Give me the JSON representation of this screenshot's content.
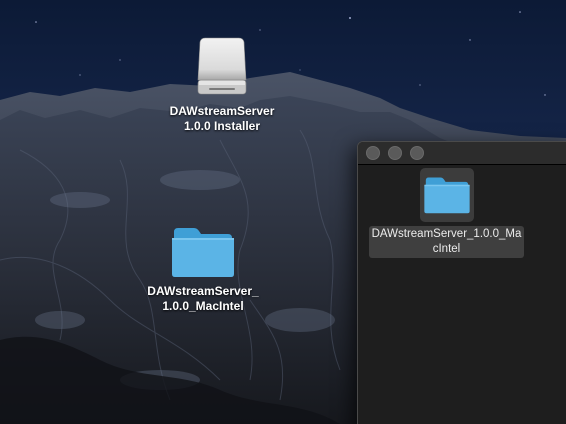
{
  "desktop": {
    "icons": [
      {
        "label_line1": "DAWstreamServer",
        "label_line2": "1.0.0 Installer",
        "icon": "disk-image-icon"
      },
      {
        "label_line1": "DAWstreamServer_",
        "label_line2": "1.0.0_MacIntel",
        "icon": "folder-icon"
      }
    ]
  },
  "finder": {
    "item": {
      "label_line1": "DAWstreamServer_1.0.0_Ma",
      "label_line2": "cIntel",
      "icon": "folder-icon"
    }
  },
  "colors": {
    "folder": "#5bb4e6",
    "folder_dark": "#3f9fd6",
    "window_bg": "#1e1e1e",
    "titlebar": "#2c2c2c"
  }
}
